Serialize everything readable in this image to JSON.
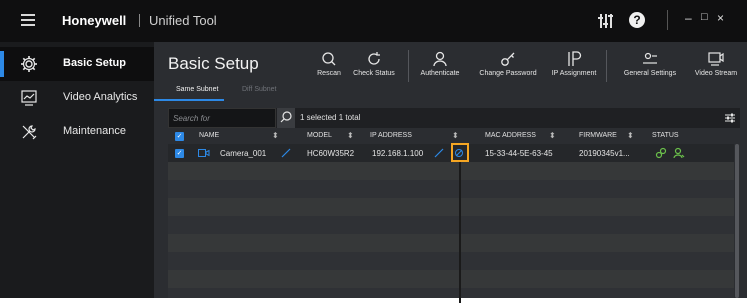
{
  "titlebar": {
    "brand": "Honeywell",
    "app_name": "Unified Tool",
    "icons": [
      "menu-icon",
      "equalizer-icon",
      "help-icon"
    ],
    "help_glyph": "?",
    "minimize": "–",
    "maximize": "□",
    "close": "×"
  },
  "sidebar": {
    "items": [
      {
        "label": "Basic Setup",
        "icon": "gear-icon",
        "active": true
      },
      {
        "label": "Video Analytics",
        "icon": "analytics-icon",
        "active": false
      },
      {
        "label": "Maintenance",
        "icon": "tools-icon",
        "active": false
      }
    ]
  },
  "main": {
    "title": "Basic Setup",
    "tools": [
      {
        "label": "Rescan",
        "icon": "search-icon"
      },
      {
        "label": "Check Status",
        "icon": "refresh-icon"
      },
      {
        "label": "Authenticate",
        "icon": "user-icon"
      },
      {
        "label": "Change Password",
        "icon": "key-icon"
      },
      {
        "label": "IP Assignment",
        "icon": "ip-icon"
      },
      {
        "label": "General Settings",
        "icon": "settings-icon"
      },
      {
        "label": "Video Stream",
        "icon": "video-stream-icon"
      }
    ],
    "tabs": [
      {
        "label": "Same Subnet",
        "active": true
      },
      {
        "label": "Diff Subnet",
        "active": false
      }
    ]
  },
  "filter": {
    "search_placeholder": "Search for",
    "selection_info": "1 selected  1 total"
  },
  "table": {
    "columns": [
      "NAME",
      "MODEL",
      "IP ADDRESS",
      "MAC ADDRESS",
      "FIRMWARE",
      "STATUS"
    ],
    "rows": [
      {
        "name": "Camera_001",
        "model": "HC60W35R2",
        "ip": "192.168.1.100",
        "mac": "15-33-44-5E-63-45",
        "firmware": "20190345v1...",
        "selected": true
      }
    ]
  },
  "colors": {
    "accent": "#2d89e6",
    "highlight": "#f5a623",
    "status_green": "#6bc04b"
  }
}
